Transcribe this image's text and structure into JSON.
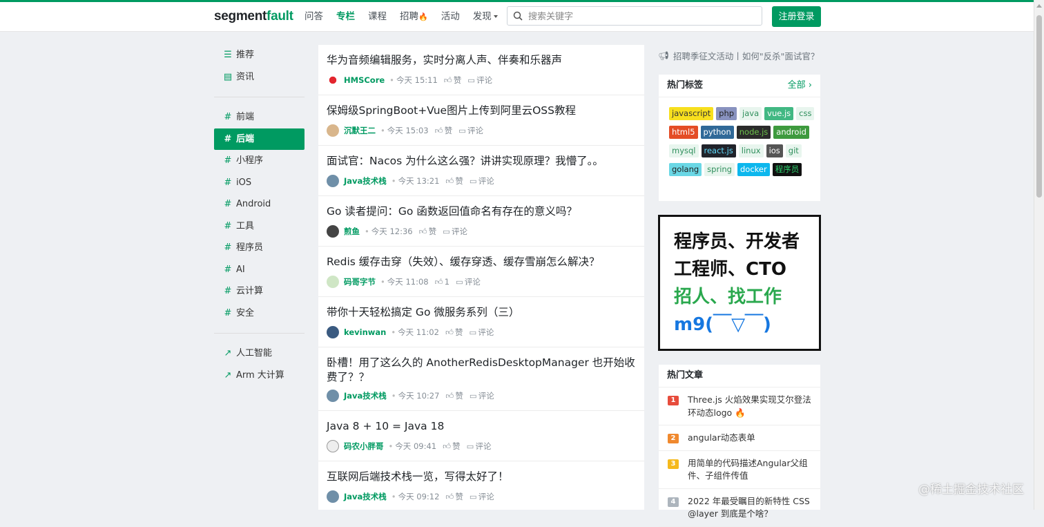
{
  "colors": {
    "brand": "#009a61",
    "fire": "#e64a19"
  },
  "header": {
    "logo_prefix": "segment",
    "logo_suffix": "fault",
    "nav": [
      {
        "label": "问答"
      },
      {
        "label": "专栏"
      },
      {
        "label": "课程"
      },
      {
        "label": "招聘"
      },
      {
        "label": "活动"
      },
      {
        "label": "发现"
      }
    ],
    "search_placeholder": "搜索关键字",
    "login_label": "注册登录"
  },
  "sidebar": {
    "top": [
      {
        "label": "推荐",
        "icon": "list-icon"
      },
      {
        "label": "资讯",
        "icon": "newspaper-icon"
      }
    ],
    "channels": [
      {
        "label": "前端"
      },
      {
        "label": "后端"
      },
      {
        "label": "小程序"
      },
      {
        "label": "iOS"
      },
      {
        "label": "Android"
      },
      {
        "label": "工具"
      },
      {
        "label": "程序员"
      },
      {
        "label": "AI"
      },
      {
        "label": "云计算"
      },
      {
        "label": "安全"
      }
    ],
    "hash": "#",
    "external": [
      {
        "label": "人工智能"
      },
      {
        "label": "Arm 大计算"
      }
    ]
  },
  "articles": [
    {
      "title": "华为音频编辑服务，实时分离人声、伴奏和乐器声",
      "author": "HMSCore",
      "time": "今天 15:11",
      "likes": "赞",
      "comments": "评论"
    },
    {
      "title": "保姆级SpringBoot+Vue图片上传到阿里云OSS教程",
      "author": "沉默王二",
      "time": "今天 15:03",
      "likes": "赞",
      "comments": "评论"
    },
    {
      "title": "面试官：Nacos 为什么这么强？讲讲实现原理？我懵了。。",
      "author": "Java技术栈",
      "time": "今天 13:21",
      "likes": "赞",
      "comments": "评论"
    },
    {
      "title": "Go 读者提问：Go 函数返回值命名有存在的意义吗？",
      "author": "煎鱼",
      "time": "今天 12:36",
      "likes": "赞",
      "comments": "评论"
    },
    {
      "title": "Redis 缓存击穿（失效）、缓存穿透、缓存雪崩怎么解决？",
      "author": "码哥字节",
      "time": "今天 11:08",
      "likes": "1",
      "comments": "评论"
    },
    {
      "title": "带你十天轻松搞定 Go 微服务系列（三）",
      "author": "kevinwan",
      "time": "今天 11:02",
      "likes": "赞",
      "comments": "评论"
    },
    {
      "title": "卧槽！用了这么久的 AnotherRedisDesktopManager 也开始收费了？？",
      "author": "Java技术栈",
      "time": "今天 10:27",
      "likes": "赞",
      "comments": "评论"
    },
    {
      "title": "Java 8 + 10 = Java 18",
      "author": "码农小胖哥",
      "time": "今天 09:41",
      "likes": "赞",
      "comments": "评论"
    },
    {
      "title": "互联网后端技术栈一览，写得太好了！",
      "author": "Java技术栈",
      "time": "今天 09:12",
      "likes": "赞",
      "comments": "评论"
    }
  ],
  "announcement": "招聘季征文活动丨如何\"反杀\"面试官？",
  "hot_tags": {
    "title": "热门标签",
    "more": "全部",
    "tags": [
      {
        "label": "javascript",
        "bg": "#f7df1e",
        "fg": "#333"
      },
      {
        "label": "php",
        "bg": "#8892bf",
        "fg": "#222"
      },
      {
        "label": "java",
        "bg": "#e8f5ee",
        "fg": "#2f8f5c"
      },
      {
        "label": "vue.js",
        "bg": "#41b883",
        "fg": "#fff"
      },
      {
        "label": "css",
        "bg": "#e8f5ee",
        "fg": "#2f8f5c"
      },
      {
        "label": "html5",
        "bg": "#e44d26",
        "fg": "#fff"
      },
      {
        "label": "python",
        "bg": "#306998",
        "fg": "#fff"
      },
      {
        "label": "node.js",
        "bg": "#2b2b2b",
        "fg": "#6cc24a"
      },
      {
        "label": "android",
        "bg": "#3e9a3e",
        "fg": "#fff"
      },
      {
        "label": "mysql",
        "bg": "#e8f5ee",
        "fg": "#2f8f5c"
      },
      {
        "label": "react.js",
        "bg": "#20232a",
        "fg": "#61dafb"
      },
      {
        "label": "linux",
        "bg": "#e8f5ee",
        "fg": "#2f8f5c"
      },
      {
        "label": "ios",
        "bg": "#555",
        "fg": "#fff"
      },
      {
        "label": "git",
        "bg": "#e8f5ee",
        "fg": "#2f8f5c"
      },
      {
        "label": "golang",
        "bg": "#6ad7e5",
        "fg": "#222"
      },
      {
        "label": "spring",
        "bg": "#e8f5ee",
        "fg": "#2f8f5c"
      },
      {
        "label": "docker",
        "bg": "#0db7ed",
        "fg": "#fff"
      },
      {
        "label": "程序员",
        "bg": "#111",
        "fg": "#2dd36f"
      }
    ]
  },
  "ad": {
    "line1": "程序员、开发者",
    "line2": "工程师、CTO",
    "line3": "招人、找工作",
    "line4": "m9(￣▽￣)"
  },
  "hot_articles": {
    "title": "热门文章",
    "items": [
      {
        "rank": "1",
        "title": "Three.js 火焰效果实现艾尔登法环动态logo",
        "emoji": "🔥",
        "color": "#e74c3c"
      },
      {
        "rank": "2",
        "title": "angular动态表单",
        "emoji": "",
        "color": "#f0892e"
      },
      {
        "rank": "3",
        "title": "用简单的代码描述Angular父组件、子组件传值",
        "emoji": "",
        "color": "#f5b91c"
      },
      {
        "rank": "4",
        "title": "2022 年最受瞩目的新特性 CSS @layer 到底是个啥？",
        "emoji": "",
        "color": "#adb5bd"
      }
    ]
  },
  "watermark": "@稀土掘金技术社区"
}
